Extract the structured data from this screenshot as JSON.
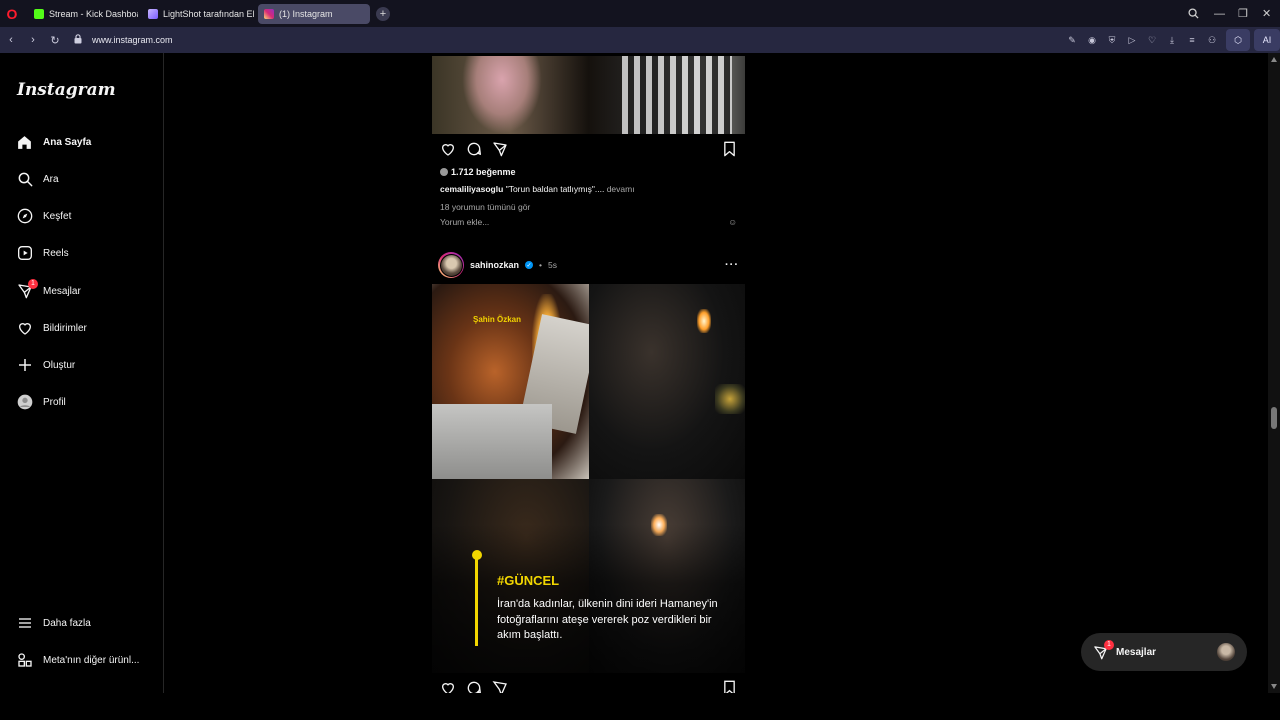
{
  "browser": {
    "tabs": [
      {
        "label": "Stream - Kick Dashboard",
        "icon": "kick-icon",
        "color": "#53fc18",
        "active": false
      },
      {
        "label": "LightShot tarafından Ekran",
        "icon": "lightshot-feather-icon",
        "color": "#a58bff",
        "active": false
      },
      {
        "label": "(1) Instagram",
        "icon": "instagram-icon",
        "color": "#e1306c",
        "active": true
      }
    ],
    "url": "www.instagram.com",
    "ai_label": "AI"
  },
  "sidebar": {
    "logo": "Instagram",
    "items": [
      {
        "label": "Ana Sayfa",
        "icon": "home-icon",
        "active": true
      },
      {
        "label": "Ara",
        "icon": "search-icon"
      },
      {
        "label": "Keşfet",
        "icon": "compass-icon"
      },
      {
        "label": "Reels",
        "icon": "reels-icon"
      },
      {
        "label": "Mesajlar",
        "icon": "messenger-icon",
        "badge": "1"
      },
      {
        "label": "Bildirimler",
        "icon": "heart-icon"
      },
      {
        "label": "Oluştur",
        "icon": "plus-icon"
      },
      {
        "label": "Profil",
        "icon": "profile-avatar-icon"
      }
    ],
    "more_label": "Daha fazla",
    "meta_label": "Meta'nın diğer ürünl..."
  },
  "post1": {
    "likes": "1.712 beğenme",
    "caption_user": "cemaliliyasoglu",
    "caption_text": "\"Torun baldan tatlıymış\"....",
    "caption_more": "devamı",
    "comments_link": "18 yorumun tümünü gör",
    "add_comment_placeholder": "Yorum ekle..."
  },
  "post2": {
    "username": "sahinozkan",
    "time": "5s",
    "watermark": "Şahin Özkan",
    "hashtag": "#GÜNCEL",
    "headline": "İran'da kadınlar, ülkenin dini ideri Hamaney'in fotoğraflarını ateşe vererek poz verdikleri bir akım başlattı."
  },
  "messages_button": {
    "label": "Mesajlar",
    "badge": "1"
  },
  "colors": {
    "accent_yellow": "#f2d600",
    "badge_red": "#ff3040",
    "verified_blue": "#0095f6"
  }
}
